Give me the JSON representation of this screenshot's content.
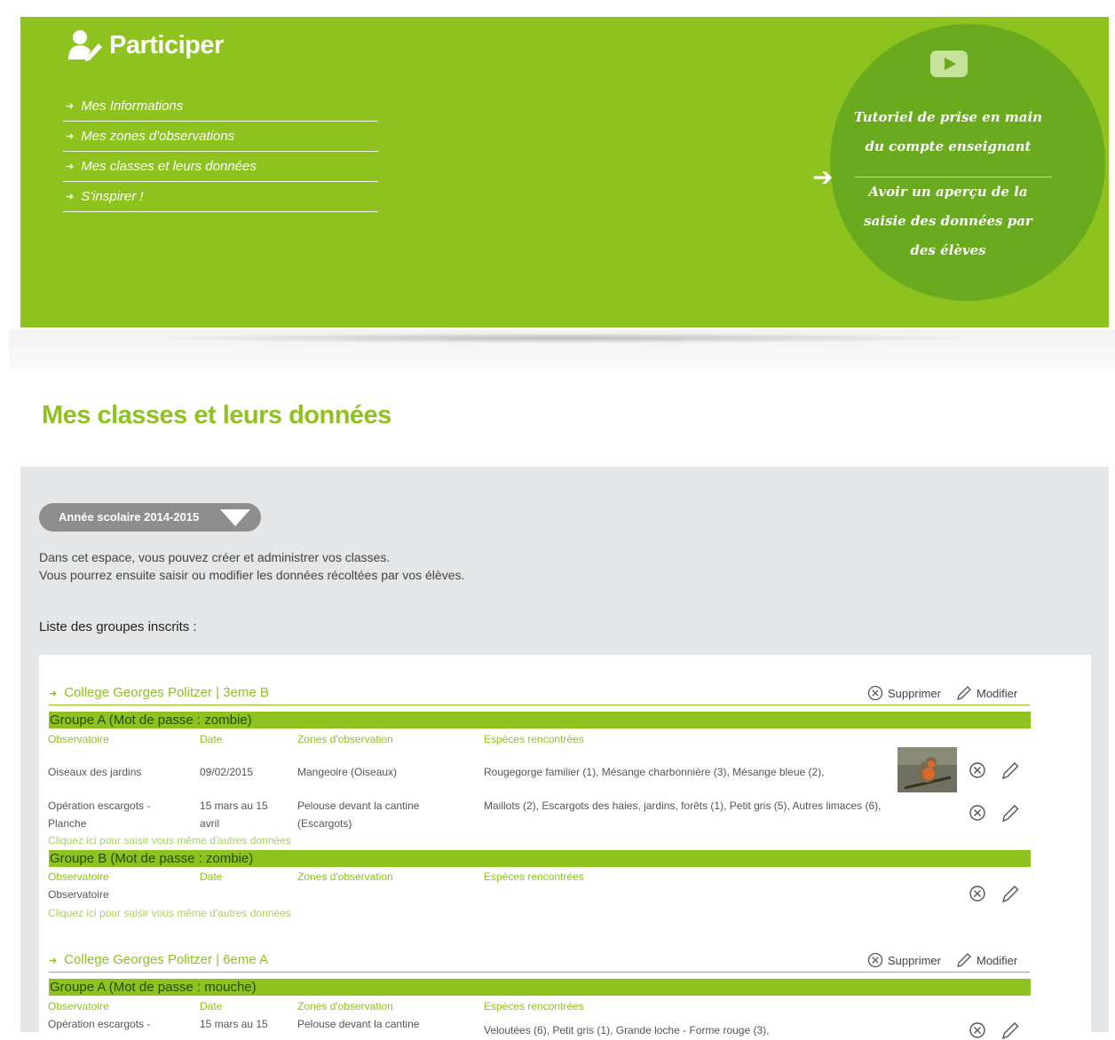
{
  "banner": {
    "title": "Participer",
    "nav": [
      {
        "label": "Mes Informations"
      },
      {
        "label": "Mes zones d'observations"
      },
      {
        "label": "Mes classes et leurs données"
      },
      {
        "label": "S'inspirer !"
      }
    ],
    "tutorial_text": "Tutoriel de prise en main du compte enseignant",
    "preview_text": "Avoir un aperçu de la saisie des données par des élèves",
    "colors": {
      "primary": "#8dc21f",
      "circle": "#69aa1f"
    }
  },
  "page": {
    "title": "Mes classes et leurs données"
  },
  "year_selector": {
    "label": "Année scolaire 2014-2015"
  },
  "intro": {
    "line1": "Dans cet espace, vous pouvez créer et administrer vos classes.",
    "line2": "Vous pourrez ensuite saisir ou modifier les données récoltées par vos élèves."
  },
  "list_label": "Liste des groupes inscrits :",
  "actions": {
    "delete": "Supprimer",
    "edit": "Modifier"
  },
  "columns": {
    "observatoire": "Observatoire",
    "date": "Date",
    "zones": "Zones d'observation",
    "especes": "Espèces rencontrées"
  },
  "add_link": "Cliquez ici pour saisir vous même d'autres données",
  "classes": [
    {
      "name": "College Georges Politzer | 3eme B",
      "groups": [
        {
          "label": "Groupe A (Mot de passe : zombie)",
          "rows": [
            {
              "observatoire": "Oiseaux des jardins",
              "date": "09/02/2015",
              "zone": "Mangeoire (Oiseaux)",
              "especes": "Rougegorge familier (1), Mésange charbonnière (3), Mésange bleue (2),"
            },
            {
              "observatoire": "Opération escargots - Planche",
              "date": "15 mars au 15 avril",
              "zone": "Pelouse devant la cantine (Escargots)",
              "especes": "Maillots (2), Escargots des haies, jardins, forêts (1), Petit gris (5), Autres limaces (6),"
            }
          ]
        },
        {
          "label": "Groupe B (Mot de passe : zombie)",
          "rows": [
            {
              "observatoire": "Observatoire"
            }
          ]
        }
      ]
    },
    {
      "name": "College Georges Politzer | 6eme A",
      "groups": [
        {
          "label": "Groupe A (Mot de passe : mouche)",
          "rows": [
            {
              "observatoire": "Opération escargots -",
              "date": "15 mars au 15",
              "zone": "Pelouse devant la cantine",
              "especes": "Veloutées (6), Petit gris (1), Grande loche - Forme rouge (3),"
            }
          ]
        }
      ]
    }
  ]
}
